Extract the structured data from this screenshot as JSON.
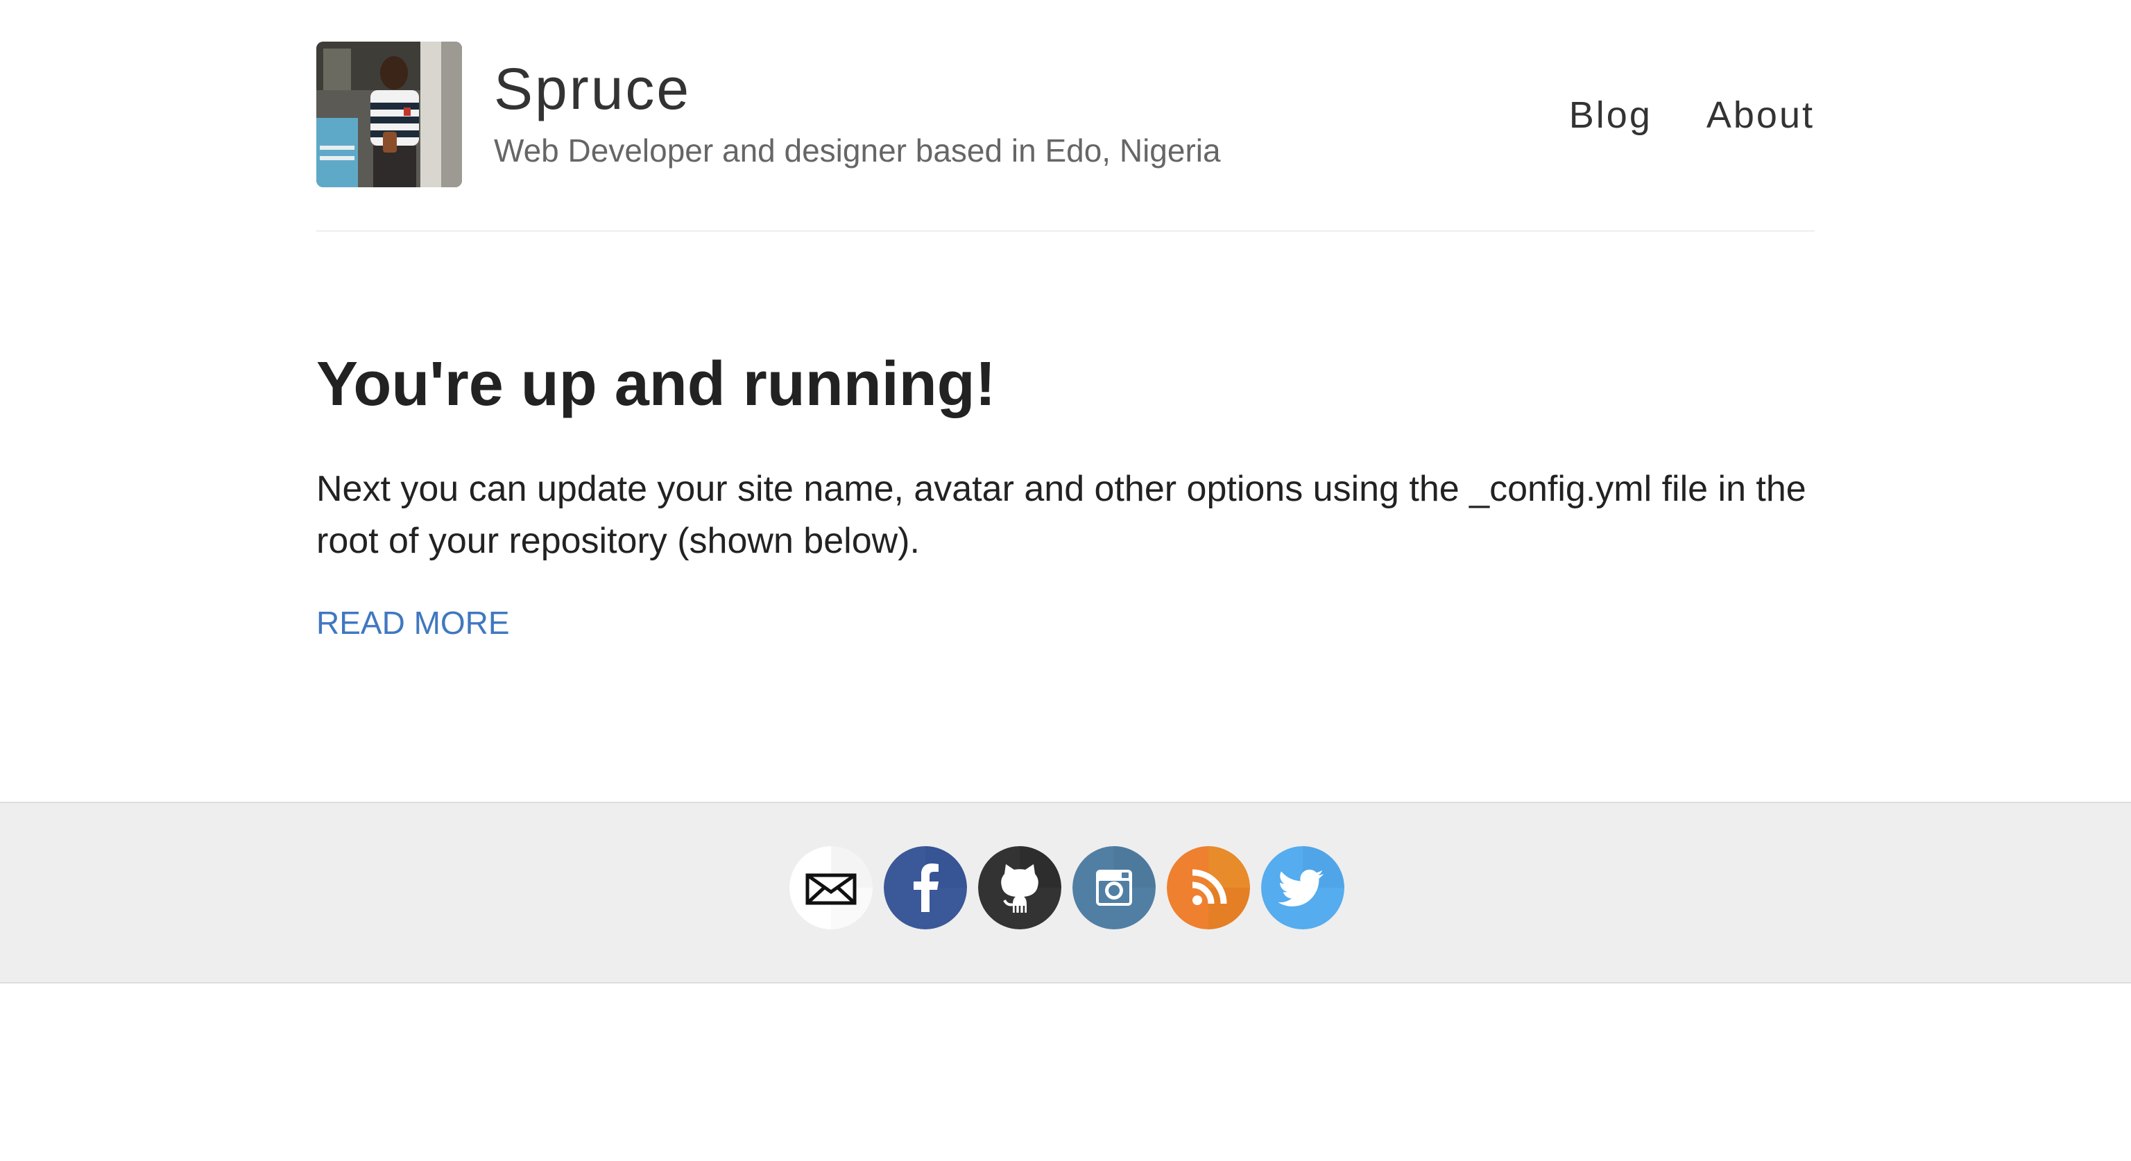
{
  "site": {
    "title": "Spruce",
    "description": "Web Developer and designer based in Edo, Nigeria"
  },
  "nav": {
    "items": [
      {
        "label": "Blog"
      },
      {
        "label": "About"
      }
    ]
  },
  "post": {
    "title": "You're up and running!",
    "excerpt": "Next you can update your site name, avatar and other options using the _config.yml file in the root of your repository (shown below).",
    "read_more": "READ MORE"
  },
  "footer": {
    "social": [
      {
        "icon": "email-icon",
        "color": "#ffffff"
      },
      {
        "icon": "facebook-icon",
        "color": "#3b5998"
      },
      {
        "icon": "github-icon",
        "color": "#333333"
      },
      {
        "icon": "instagram-icon",
        "color": "#517fa4"
      },
      {
        "icon": "rss-icon",
        "color": "#ee802f"
      },
      {
        "icon": "twitter-icon",
        "color": "#55acee"
      }
    ]
  }
}
